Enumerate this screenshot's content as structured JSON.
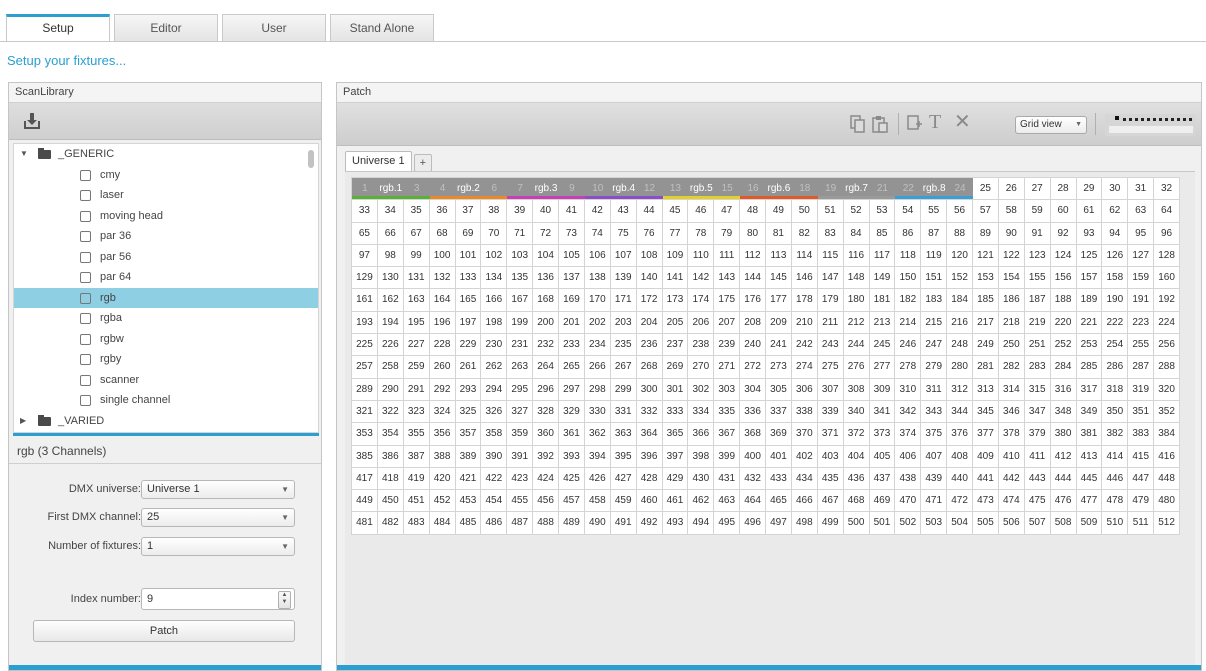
{
  "tabs": [
    "Setup",
    "Editor",
    "User",
    "Stand Alone"
  ],
  "active_tab": "Setup",
  "subtitle": "Setup your fixtures...",
  "library": {
    "title": "ScanLibrary",
    "tree": [
      {
        "label": "_GENERIC",
        "type": "folder",
        "expanded": true
      },
      {
        "label": "cmy",
        "type": "item"
      },
      {
        "label": "laser",
        "type": "item"
      },
      {
        "label": "moving head",
        "type": "item"
      },
      {
        "label": "par 36",
        "type": "item"
      },
      {
        "label": "par 56",
        "type": "item"
      },
      {
        "label": "par 64",
        "type": "item"
      },
      {
        "label": "rgb",
        "type": "item",
        "selected": true
      },
      {
        "label": "rgba",
        "type": "item"
      },
      {
        "label": "rgbw",
        "type": "item"
      },
      {
        "label": "rgby",
        "type": "item"
      },
      {
        "label": "scanner",
        "type": "item"
      },
      {
        "label": "single channel",
        "type": "item"
      },
      {
        "label": "_VARIED",
        "type": "folder",
        "expanded": false
      }
    ]
  },
  "fixture_info": {
    "title": "rgb (3 Channels)",
    "dmx_universe_label": "DMX universe:",
    "dmx_universe_value": "Universe 1",
    "first_channel_label": "First DMX channel:",
    "first_channel_value": "25",
    "num_fixtures_label": "Number of fixtures:",
    "num_fixtures_value": "1",
    "index_label": "Index number:",
    "index_value": "9",
    "patch_button": "Patch"
  },
  "patch": {
    "title": "Patch",
    "view_mode": "Grid view",
    "universe_tab": "Universe 1",
    "add_tab": "+",
    "channel_count": 512,
    "columns": 32,
    "fixtures": [
      {
        "name": "rgb.1",
        "start": 1,
        "channels": 3,
        "color": "#5bb03a"
      },
      {
        "name": "rgb.2",
        "start": 4,
        "channels": 3,
        "color": "#e8892a"
      },
      {
        "name": "rgb.3",
        "start": 7,
        "channels": 3,
        "color": "#c73fb5"
      },
      {
        "name": "rgb.4",
        "start": 10,
        "channels": 3,
        "color": "#8a4fc4"
      },
      {
        "name": "rgb.5",
        "start": 13,
        "channels": 3,
        "color": "#e2d12a"
      },
      {
        "name": "rgb.6",
        "start": 16,
        "channels": 3,
        "color": "#e0592a"
      },
      {
        "name": "rgb.7",
        "start": 19,
        "channels": 3,
        "color": "#9a9a9a"
      },
      {
        "name": "rgb.8",
        "start": 22,
        "channels": 3,
        "color": "#3a9fd6"
      }
    ]
  },
  "toolbar_icons": [
    "copy-icon",
    "paste-icon",
    "duplicate-icon",
    "text-icon",
    "delete-icon"
  ],
  "accent_color": "#2a9fd0"
}
